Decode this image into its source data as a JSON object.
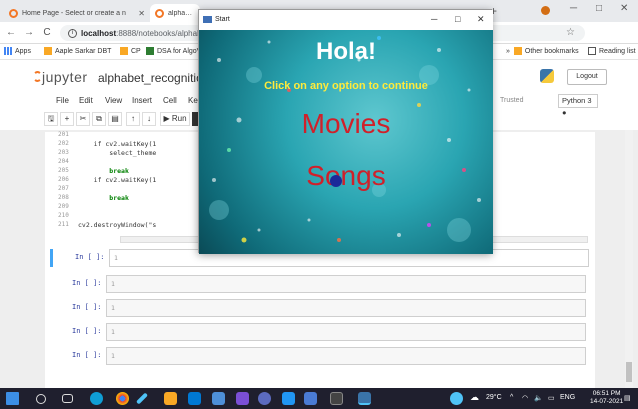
{
  "browser": {
    "tabs": [
      {
        "label": "Home Page - Select or create a n",
        "active": false
      },
      {
        "label": "alphabet_recognitio",
        "active": true
      }
    ],
    "address": {
      "host": "localhost",
      "path": ":8888/notebooks/alphabet_re"
    },
    "bookmarks": [
      "Apps",
      "Aaple Sarkar DBT",
      "CP",
      "DSA for AlgoViz"
    ],
    "other_bookmarks": "Other bookmarks",
    "reading_list": "Reading list"
  },
  "jupyter": {
    "logo": "jupyter",
    "notebook_name": "alphabet_recognition",
    "logout": "Logout",
    "menu": [
      "File",
      "Edit",
      "View",
      "Insert",
      "Cell",
      "Ke"
    ],
    "trusted": "Trusted",
    "kernel": "Python 3",
    "run_label": "Run",
    "code_lines": [
      {
        "num": "201",
        "text": ""
      },
      {
        "num": "202",
        "text": "    if cv2.waitKey(1"
      },
      {
        "num": "203",
        "text": "        select_theme"
      },
      {
        "num": "204",
        "text": ""
      },
      {
        "num": "205",
        "text": "        break"
      },
      {
        "num": "206",
        "text": "    if cv2.waitKey(1"
      },
      {
        "num": "207",
        "text": ""
      },
      {
        "num": "208",
        "text": "        break"
      },
      {
        "num": "209",
        "text": ""
      },
      {
        "num": "210",
        "text": ""
      },
      {
        "num": "211",
        "text": "cv2.destroyWindow(\"s"
      }
    ],
    "empty_cells": [
      {
        "prompt": "In [ ]:",
        "line": "1"
      },
      {
        "prompt": "In [ ]:",
        "line": "1"
      },
      {
        "prompt": "In [ ]:",
        "line": "1"
      },
      {
        "prompt": "In [ ]:",
        "line": "1"
      },
      {
        "prompt": "In [ ]:",
        "line": "1"
      }
    ]
  },
  "dialog": {
    "title": "Start",
    "heading": "Hola!",
    "subheading": "Click on any option to continue",
    "options": [
      "Movies",
      "Songs"
    ]
  },
  "taskbar": {
    "weather": "29°C",
    "language": "ENG",
    "time": "06:51 PM",
    "date": "14-07-2021"
  }
}
